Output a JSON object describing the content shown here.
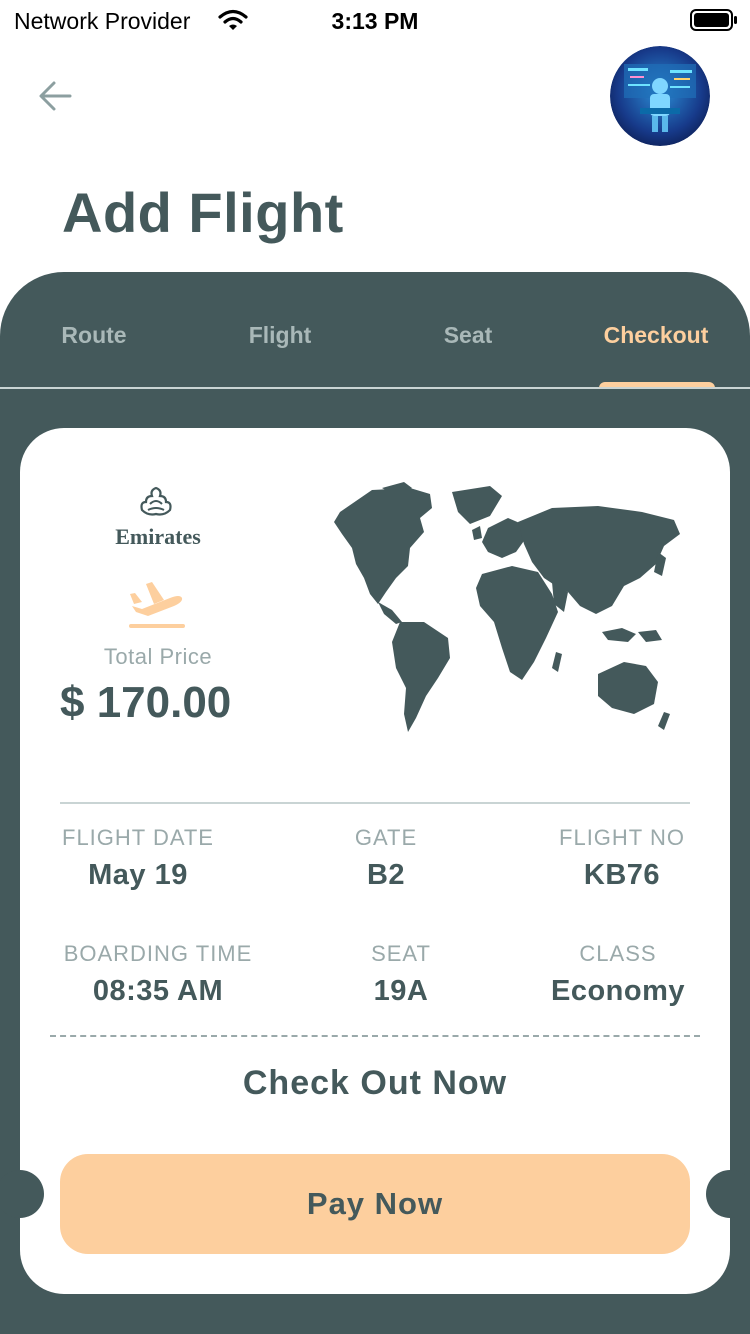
{
  "status_bar": {
    "carrier": "Network Provider",
    "time": "3:13 PM",
    "icons": [
      "wifi-icon",
      "battery-icon"
    ]
  },
  "header": {
    "back_icon": "arrow-left-icon",
    "avatar": "user-avatar",
    "title": "Add Flight"
  },
  "tabs": [
    {
      "label": "Route",
      "active": false
    },
    {
      "label": "Flight",
      "active": false
    },
    {
      "label": "Seat",
      "active": false
    },
    {
      "label": "Checkout",
      "active": true
    }
  ],
  "ticket": {
    "airline": "Emirates",
    "plane_icon": "plane-takeoff-icon",
    "price_label": "Total Price",
    "price": "$ 170.00",
    "details": {
      "flight_date": {
        "label": "FLIGHT DATE",
        "value": "May 19"
      },
      "gate": {
        "label": "GATE",
        "value": "B2"
      },
      "flight_no": {
        "label": "FLIGHT NO",
        "value": "KB76"
      },
      "boarding_time": {
        "label": "BOARDING TIME",
        "value": "08:35 AM"
      },
      "seat": {
        "label": "SEAT",
        "value": "19A"
      },
      "class": {
        "label": "CLASS",
        "value": "Economy"
      }
    },
    "checkout_title": "Check Out Now",
    "pay_button": "Pay Now"
  },
  "colors": {
    "primary": "#44595b",
    "accent": "#fdcf9e",
    "muted": "#9aa9aa",
    "background": "#ffffff"
  }
}
